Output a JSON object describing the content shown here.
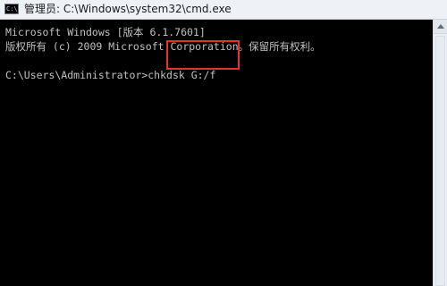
{
  "window": {
    "title": "管理员: C:\\Windows\\system32\\cmd.exe",
    "icon": "cmd-icon",
    "icon_text": "C:\\"
  },
  "console": {
    "lines": [
      "Microsoft Windows [版本 6.1.7601]",
      "版权所有 (c) 2009 Microsoft Corporation。保留所有权利。"
    ],
    "prompt": "C:\\Users\\Administrator>",
    "command": "chkdsk G:/f"
  },
  "colors": {
    "highlight": "#e5332a",
    "console_bg": "#000000",
    "console_text": "#c0c0c0"
  }
}
